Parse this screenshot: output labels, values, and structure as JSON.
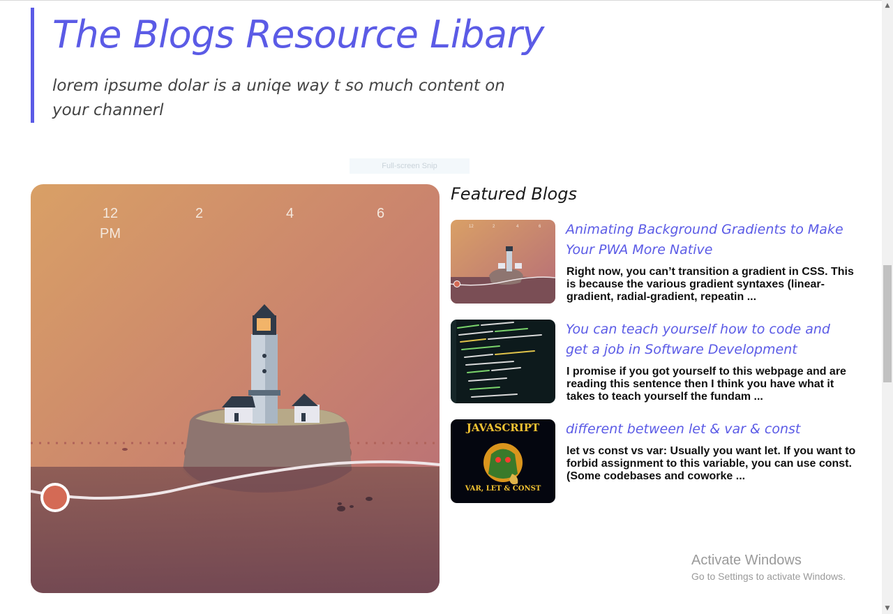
{
  "hero": {
    "title": "The Blogs Resource Libary",
    "subtitle": "lorem ipsume dolar is a uniqe way t so much content on your channerl",
    "accent_color": "#5b5be6"
  },
  "snip_label": "Full-screen Snip",
  "feature_image": {
    "icon": "lighthouse-illustration",
    "time_labels": [
      "12\nPM",
      "2",
      "4",
      "6"
    ]
  },
  "featured": {
    "heading": "Featured Blogs",
    "posts": [
      {
        "thumb_icon": "lighthouse-thumbnail",
        "title": "Animating Background Gradients to Make Your PWA More Native",
        "excerpt": "Right now, you can’t transition a gradient in CSS. This is because the various gradient syntaxes (linear-gradient, radial-gradient, repeatin ..."
      },
      {
        "thumb_icon": "code-screen-thumbnail",
        "title": "You can teach yourself how to code and get a job in Software Development",
        "excerpt": "I promise if you got yourself to this webpage and are reading this sentence then I think you have what it takes to teach yourself the fundam ..."
      },
      {
        "thumb_icon": "javascript-thumbnail",
        "thumb_text_top": "JAVASCRIPT",
        "thumb_text_bottom": "VAR, LET & CONST",
        "title": "different between let & var & const",
        "excerpt": "let vs const vs var: Usually you want let. If you want to forbid assignment to this variable, you can use const. (Some codebases and coworke ..."
      }
    ]
  },
  "watermark": {
    "line1": "Activate Windows",
    "line2": "Go to Settings to activate Windows."
  }
}
